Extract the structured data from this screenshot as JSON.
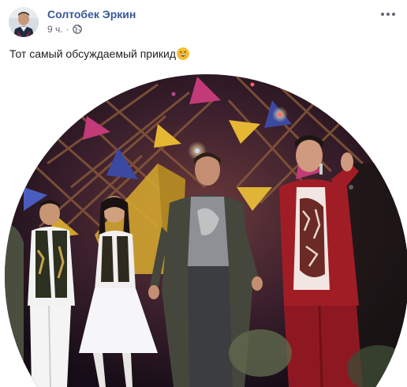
{
  "post": {
    "author": "Солтобек Эркин",
    "time": "9 ч.",
    "separator": "·",
    "privacy_icon": "globe-icon",
    "menu_icon": "more-horizontal-icon",
    "text": "Тот самый обсуждаемый прикид",
    "emoji": "grinning-face-emoji"
  },
  "colors": {
    "author_link": "#385898",
    "meta_gray": "#606770",
    "text": "#1c1e21"
  }
}
